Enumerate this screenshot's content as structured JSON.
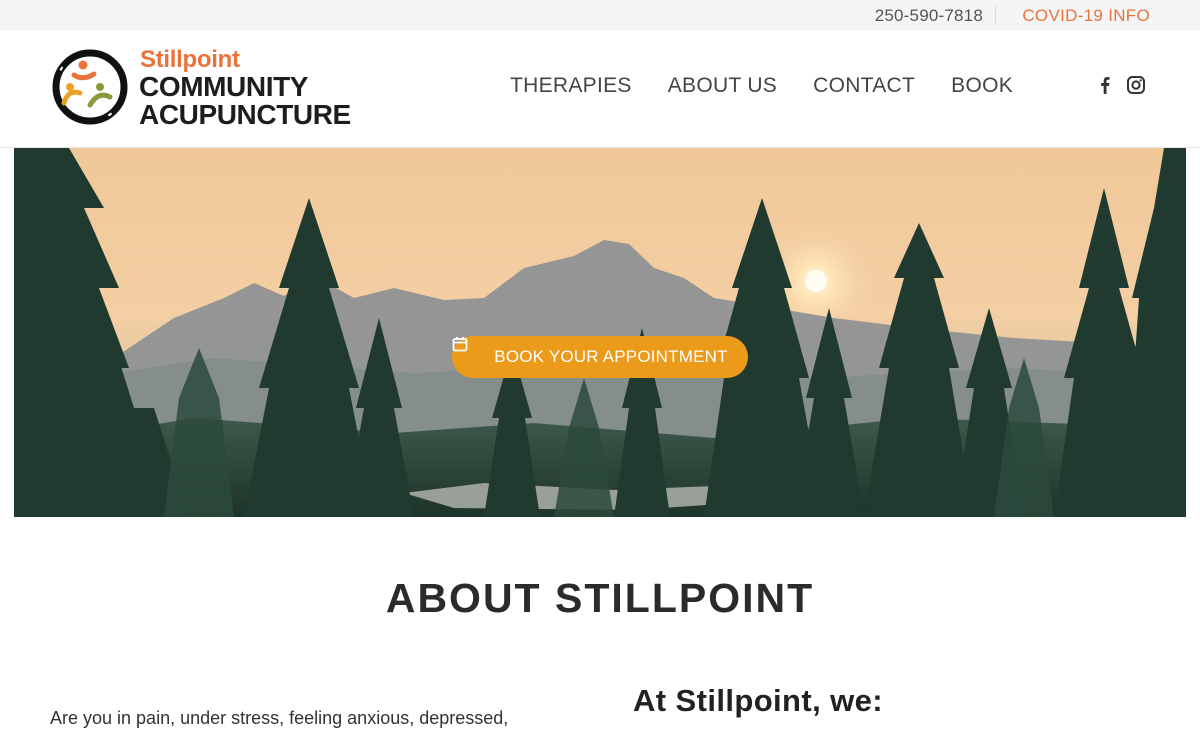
{
  "topbar": {
    "phone": "250-590-7818",
    "covid_link": "COVID-19 INFO"
  },
  "logo": {
    "line1": "Stillpoint",
    "line2": "COMMUNITY",
    "line3": "ACUPUNCTURE"
  },
  "nav": {
    "items": [
      "THERAPIES",
      "ABOUT US",
      "CONTACT",
      "BOOK"
    ],
    "social": [
      "facebook-icon",
      "instagram-icon"
    ]
  },
  "hero": {
    "button_label": "BOOK YOUR APPOINTMENT",
    "button_icon": "calendar-icon"
  },
  "about": {
    "title": "ABOUT STILLPOINT",
    "intro": "Are you in pain, under stress, feeling anxious, depressed,",
    "we_heading": "At Stillpoint, we:"
  },
  "colors": {
    "accent_orange": "#e8743b",
    "button_orange": "#eb9a1a",
    "topbar_bg": "#f5f5f5"
  }
}
